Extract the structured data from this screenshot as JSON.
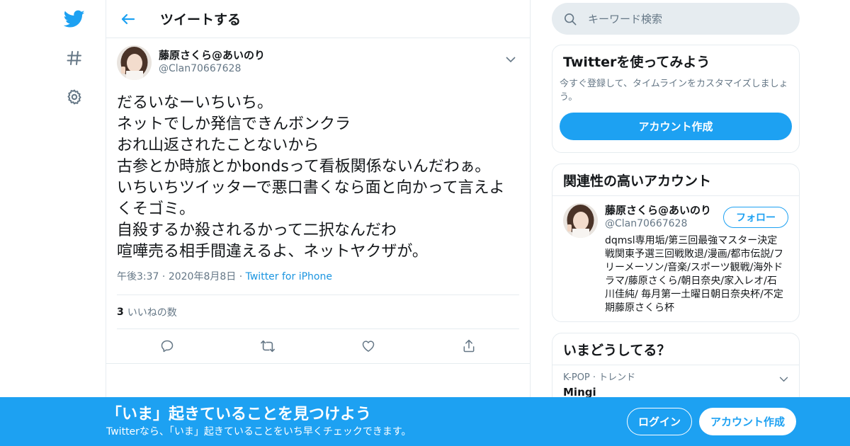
{
  "brand": {
    "accent": "#1da1f2",
    "text_primary": "#14171a",
    "text_secondary": "#657786",
    "border": "#e6ecf0"
  },
  "nav": {
    "items": [
      {
        "icon": "twitter-bird-icon"
      },
      {
        "icon": "hashtag-icon"
      },
      {
        "icon": "gear-icon"
      }
    ]
  },
  "header": {
    "title": "ツイートする"
  },
  "tweet": {
    "display_name": "藤原さくら@あいのり",
    "handle": "@Clan70667628",
    "text": "だるいなーいちいち。\nネットでしか発信できんボンクラ\nおれ山返されたことないから\n古参とか時旅とかbondsって看板関係ないんだわぁ。\nいちいちツイッターで悪口書くなら面と向かって言えよくそゴミ。\n自殺するか殺されるかって二択なんだわ\n喧嘩売る相手間違えるよ、ネットヤクザが。",
    "time": "午後3:37",
    "sep": "·",
    "date": "2020年8月8日",
    "source": "Twitter for iPhone",
    "likes_count": "3",
    "likes_label": "いいねの数"
  },
  "search": {
    "placeholder": "キーワード検索"
  },
  "signup_card": {
    "title": "Twitterを使ってみよう",
    "desc": "今すぐ登録して、タイムラインをカスタマイズしましょう。",
    "button": "アカウント作成"
  },
  "related": {
    "title": "関連性の高いアカウント",
    "user": {
      "display_name": "藤原さくら@あいのり",
      "handle": "@Clan70667628",
      "bio": "dqmsl専用垢/第三回最強マスター決定戦関東予選三回戦敗退/漫画/都市伝説/フリーメーソン/音楽/スポーツ観戦/海外ドラマ/藤原さくら/朝日奈央/家入レオ/石川佳純/ 毎月第一土曜日朝日奈央杯/不定期藤原さくら杯",
      "follow": "フォロー"
    }
  },
  "trends": {
    "title": "いまどうしてる？",
    "items": [
      {
        "meta": "K-POP · トレンド",
        "name": "Mingi"
      }
    ]
  },
  "banner": {
    "title": "「いま」起きていることを見つけよう",
    "sub": "Twitterなら、「いま」起きていることをいち早くチェックできます。",
    "login": "ログイン",
    "signup": "アカウント作成"
  }
}
